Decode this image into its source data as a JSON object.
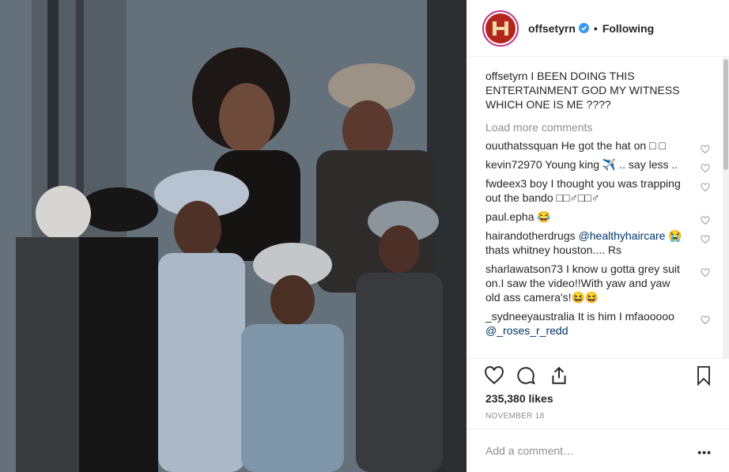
{
  "post": {
    "username": "offsetyrn",
    "follow_state": "Following",
    "caption_user": "offsetyrn",
    "caption_text": "I BEEN DOING THIS ENTERTAINMENT GOD MY WITNESS WHICH ONE IS ME ????",
    "load_more": "Load more comments",
    "likes": "235,380 likes",
    "date": "NOVEMBER 18",
    "comment_placeholder": "Add a comment…",
    "more_label": "•••"
  },
  "comments": [
    {
      "user": "ouuthatssquan",
      "text": "He got the hat on □ □"
    },
    {
      "user": "kevin72970",
      "text": "Young king ✈️ .. say less .."
    },
    {
      "user": "fwdeex3",
      "text": "boy I thought you was trapping out the bando □□♂□□♂"
    },
    {
      "user": "paul.epha",
      "text": "😂"
    },
    {
      "user": "hairandotherdrugs",
      "mention": "@healthyhaircare",
      "text": "😭 thats whitney houston.... Rs"
    },
    {
      "user": "sharlawatson73",
      "text": "I know u gotta grey suit on.I saw the video!!With yaw and yaw old ass camera's!😆😆"
    },
    {
      "user": "_sydneeyaustralia",
      "text": "It is him I mfaooooo",
      "mention": "@_roses_r_redd"
    }
  ],
  "icons": {
    "verified": "verified-badge-icon",
    "like": "heart-icon",
    "comment": "comment-bubble-icon",
    "share": "share-icon",
    "save": "bookmark-icon",
    "accent": "#3897f0"
  }
}
